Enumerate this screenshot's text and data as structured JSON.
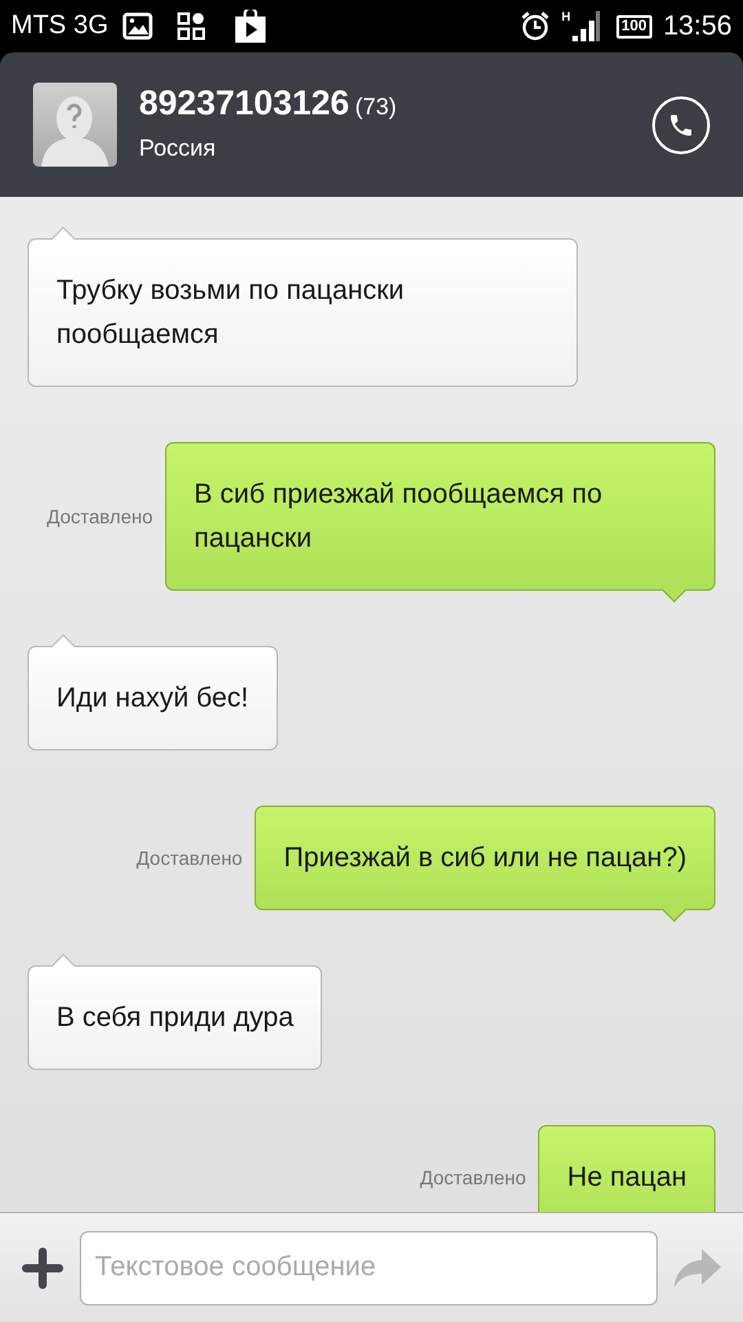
{
  "status_bar": {
    "carrier": "MTS 3G",
    "network_type": "H",
    "battery": "100",
    "time": "13:56"
  },
  "header": {
    "number": "89237103126",
    "count": "(73)",
    "region": "Россия"
  },
  "messages": [
    {
      "kind": "incoming",
      "text": "Трубку возьми по пацански пообщаемся"
    },
    {
      "kind": "outgoing",
      "text": "В сиб приезжай пообщаемся по пацански",
      "status": "Доставлено"
    },
    {
      "kind": "incoming",
      "text": "Иди нахуй бес!"
    },
    {
      "kind": "outgoing",
      "text": "Приезжай в сиб или не пацан?)",
      "status": "Доставлено"
    },
    {
      "kind": "incoming",
      "text": "В себя приди дура"
    },
    {
      "kind": "outgoing",
      "text": "Не пацан",
      "status": "Доставлено"
    }
  ],
  "composer": {
    "placeholder": "Текстовое сообщение"
  }
}
